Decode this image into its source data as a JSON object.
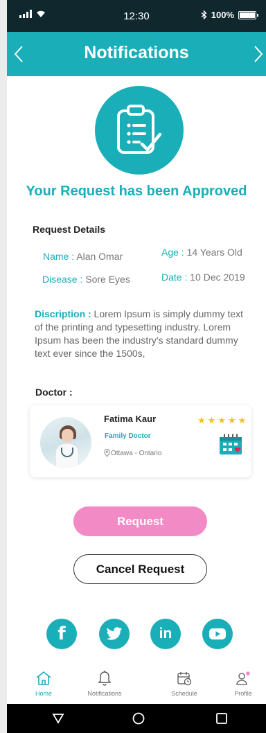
{
  "status_bar": {
    "time": "12:30",
    "battery": "100%"
  },
  "header": {
    "title": "Notifications"
  },
  "approval": {
    "title": "Your Request has been Approved"
  },
  "request_details": {
    "heading": "Request Details",
    "name_label": "Name :",
    "name_value": " Alan Omar",
    "age_label": "Age :",
    "age_value": " 14 Years Old",
    "disease_label": "Disease :",
    "disease_value": " Sore Eyes",
    "date_label": "Date :",
    "date_value": " 10 Dec 2019",
    "description_label": "Discription :",
    "description_text": " Lorem Ipsum is simply dummy text of the printing and typesetting industry. Lorem Ipsum has been the industry's standard dummy text ever since the 1500s,"
  },
  "doctor": {
    "heading": "Doctor :",
    "name": "Fatima Kaur",
    "specialty": "Family Doctor",
    "location": "Ottawa - Ontario",
    "rating": 5,
    "star_glyph": "★"
  },
  "buttons": {
    "request": "Request",
    "cancel": "Cancel Request"
  },
  "social": [
    {
      "icon": "facebook-icon",
      "glyph": "f"
    },
    {
      "icon": "twitter-icon",
      "glyph": ""
    },
    {
      "icon": "linkedin-icon",
      "glyph": "in"
    },
    {
      "icon": "youtube-icon",
      "glyph": ""
    }
  ],
  "bottom_nav": {
    "home": "Home",
    "notifications": "Notifications",
    "schedule": "Schedule",
    "profile": "Profile"
  },
  "colors": {
    "accent": "#1aaeb9",
    "request_button": "#f28ac6",
    "status_bar": "#10272e",
    "star": "#f4c21a"
  }
}
